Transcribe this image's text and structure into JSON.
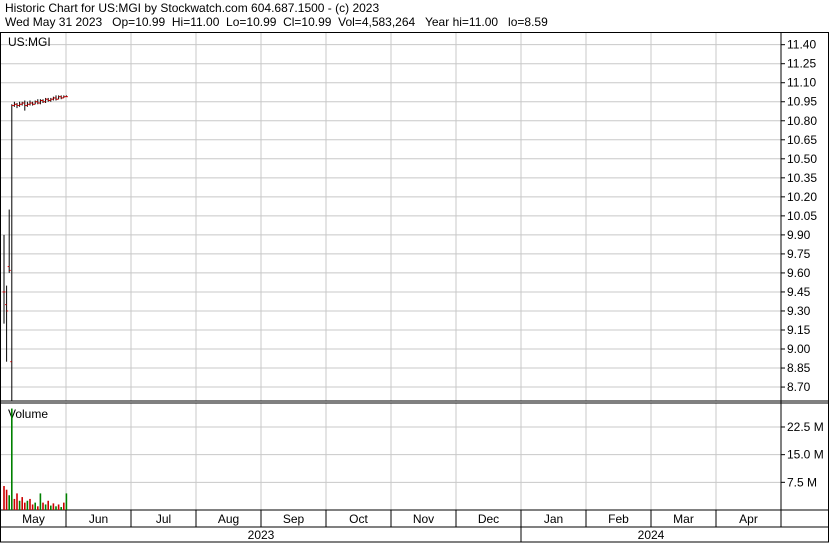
{
  "header": {
    "line1": "Historic Chart for US:MGI by Stockwatch.com 604.687.1500 - (c) 2023",
    "line2": "Wed May 31 2023   Op=10.99  Hi=11.00  Lo=10.99  Cl=10.99  Vol=4,583,264   Year hi=11.00   lo=8.59"
  },
  "colors": {
    "up": "#008000",
    "down": "#cc0000",
    "grid": "#c8c8c8",
    "frame": "#000000"
  },
  "chart_data": {
    "type": "line",
    "symbol": "US:MGI",
    "price_panel": {
      "label": "US:MGI",
      "y_ticks": [
        11.4,
        11.25,
        11.1,
        10.95,
        10.8,
        10.65,
        10.5,
        10.35,
        10.2,
        10.05,
        9.9,
        9.75,
        9.6,
        9.45,
        9.3,
        9.15,
        9.0,
        8.85,
        8.7
      ],
      "ylim": [
        8.59,
        11.5
      ],
      "bars": [
        {
          "day": 0,
          "lo": 9.2,
          "hi": 9.9,
          "op": 9.45,
          "cl": 9.45
        },
        {
          "day": 1,
          "lo": 8.9,
          "hi": 9.5,
          "op": 9.35,
          "cl": 9.3
        },
        {
          "day": 2,
          "lo": 9.6,
          "hi": 10.1,
          "op": 9.65,
          "cl": 9.62
        },
        {
          "day": 3,
          "lo": 8.59,
          "hi": 10.93,
          "op": 8.9,
          "cl": 10.92
        },
        {
          "day": 4,
          "lo": 10.91,
          "hi": 10.95,
          "op": 10.92,
          "cl": 10.93
        },
        {
          "day": 5,
          "lo": 10.9,
          "hi": 10.94,
          "op": 10.93,
          "cl": 10.92
        },
        {
          "day": 6,
          "lo": 10.91,
          "hi": 10.95,
          "op": 10.92,
          "cl": 10.93
        },
        {
          "day": 7,
          "lo": 10.92,
          "hi": 10.95,
          "op": 10.93,
          "cl": 10.94
        },
        {
          "day": 8,
          "lo": 10.88,
          "hi": 10.96,
          "op": 10.94,
          "cl": 10.92
        },
        {
          "day": 9,
          "lo": 10.91,
          "hi": 10.95,
          "op": 10.92,
          "cl": 10.93
        },
        {
          "day": 10,
          "lo": 10.92,
          "hi": 10.96,
          "op": 10.93,
          "cl": 10.94
        },
        {
          "day": 11,
          "lo": 10.92,
          "hi": 10.95,
          "op": 10.94,
          "cl": 10.93
        },
        {
          "day": 12,
          "lo": 10.93,
          "hi": 10.96,
          "op": 10.93,
          "cl": 10.95
        },
        {
          "day": 13,
          "lo": 10.93,
          "hi": 10.97,
          "op": 10.95,
          "cl": 10.94
        },
        {
          "day": 14,
          "lo": 10.93,
          "hi": 10.97,
          "op": 10.94,
          "cl": 10.96
        },
        {
          "day": 15,
          "lo": 10.94,
          "hi": 10.97,
          "op": 10.96,
          "cl": 10.95
        },
        {
          "day": 16,
          "lo": 10.94,
          "hi": 10.98,
          "op": 10.95,
          "cl": 10.97
        },
        {
          "day": 17,
          "lo": 10.95,
          "hi": 10.98,
          "op": 10.97,
          "cl": 10.96
        },
        {
          "day": 18,
          "lo": 10.95,
          "hi": 10.98,
          "op": 10.96,
          "cl": 10.97
        },
        {
          "day": 19,
          "lo": 10.96,
          "hi": 10.99,
          "op": 10.97,
          "cl": 10.98
        },
        {
          "day": 20,
          "lo": 10.96,
          "hi": 11.0,
          "op": 10.98,
          "cl": 10.97
        },
        {
          "day": 21,
          "lo": 10.97,
          "hi": 11.0,
          "op": 10.97,
          "cl": 10.99
        },
        {
          "day": 22,
          "lo": 10.97,
          "hi": 11.0,
          "op": 10.99,
          "cl": 10.98
        },
        {
          "day": 23,
          "lo": 10.98,
          "hi": 11.0,
          "op": 10.98,
          "cl": 10.99
        },
        {
          "day": 24,
          "lo": 10.99,
          "hi": 11.0,
          "op": 10.99,
          "cl": 10.99
        }
      ]
    },
    "volume_panel": {
      "label": "Volume",
      "y_ticks": [
        {
          "value": 22.5,
          "label": "22.5 M"
        },
        {
          "value": 15.0,
          "label": "15.0 M"
        },
        {
          "value": 7.5,
          "label": "7.5 M"
        }
      ],
      "ylim": [
        0,
        29
      ],
      "unit": "M",
      "values": [
        {
          "day": 0,
          "v": 6.5,
          "up": false
        },
        {
          "day": 1,
          "v": 5.5,
          "up": false
        },
        {
          "day": 2,
          "v": 4.0,
          "up": true
        },
        {
          "day": 3,
          "v": 27.5,
          "up": true
        },
        {
          "day": 4,
          "v": 3.0,
          "up": false
        },
        {
          "day": 5,
          "v": 4.5,
          "up": false
        },
        {
          "day": 6,
          "v": 2.5,
          "up": true
        },
        {
          "day": 7,
          "v": 3.5,
          "up": false
        },
        {
          "day": 8,
          "v": 2.0,
          "up": false
        },
        {
          "day": 9,
          "v": 2.5,
          "up": true
        },
        {
          "day": 10,
          "v": 3.0,
          "up": false
        },
        {
          "day": 11,
          "v": 1.5,
          "up": false
        },
        {
          "day": 12,
          "v": 2.0,
          "up": true
        },
        {
          "day": 13,
          "v": 1.0,
          "up": false
        },
        {
          "day": 14,
          "v": 4.5,
          "up": true
        },
        {
          "day": 15,
          "v": 2.0,
          "up": false
        },
        {
          "day": 16,
          "v": 1.5,
          "up": true
        },
        {
          "day": 17,
          "v": 2.5,
          "up": false
        },
        {
          "day": 18,
          "v": 1.2,
          "up": true
        },
        {
          "day": 19,
          "v": 1.8,
          "up": false
        },
        {
          "day": 20,
          "v": 1.0,
          "up": true
        },
        {
          "day": 21,
          "v": 1.5,
          "up": false
        },
        {
          "day": 22,
          "v": 0.8,
          "up": true
        },
        {
          "day": 23,
          "v": 2.0,
          "up": false
        },
        {
          "day": 24,
          "v": 4.5,
          "up": true
        }
      ]
    },
    "x_months": [
      "May",
      "Jun",
      "Jul",
      "Aug",
      "Sep",
      "Oct",
      "Nov",
      "Dec",
      "Jan",
      "Feb",
      "Mar",
      "Apr"
    ],
    "x_years": [
      "2023",
      "2024"
    ],
    "grid": true
  }
}
